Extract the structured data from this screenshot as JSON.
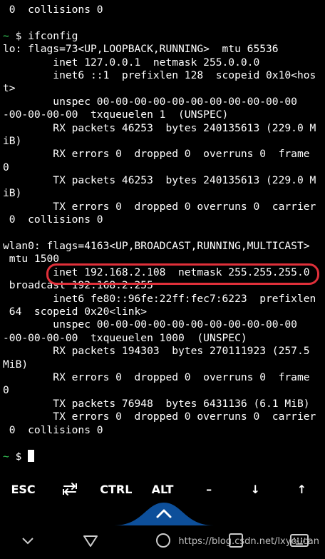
{
  "terminal": {
    "lines": [
      " 0  collisions 0",
      "",
      "~ $ ifconfig",
      "lo: flags=73<UP,LOOPBACK,RUNNING>  mtu 65536",
      "        inet 127.0.0.1  netmask 255.0.0.0",
      "        inet6 ::1  prefixlen 128  scopeid 0x10<hos",
      "t>",
      "        unspec 00-00-00-00-00-00-00-00-00-00-00",
      "-00-00-00-00  txqueuelen 1  (UNSPEC)",
      "        RX packets 46253  bytes 240135613 (229.0 M",
      "iB)",
      "        RX errors 0  dropped 0  overruns 0  frame",
      "0",
      "        TX packets 46253  bytes 240135613 (229.0 M",
      "iB)",
      "        TX errors 0  dropped 0 overruns 0  carrier",
      " 0  collisions 0",
      "",
      "wlan0: flags=4163<UP,BROADCAST,RUNNING,MULTICAST>",
      " mtu 1500",
      "        inet 192.168.2.108  netmask 255.255.255.0",
      " broadcast 192.168.2.255",
      "        inet6 fe80::96fe:22ff:fec7:6223  prefixlen",
      " 64  scopeid 0x20<link>",
      "        unspec 00-00-00-00-00-00-00-00-00-00-00",
      "-00-00-00-00  txqueuelen 1000  (UNSPEC)",
      "        RX packets 194303  bytes 270111923 (257.5",
      "MiB)",
      "        RX errors 0  dropped 0  overruns 0  frame",
      "0",
      "        TX packets 76948  bytes 6431136 (6.1 MiB)",
      "        TX errors 0  dropped 0 overruns 0  carrier",
      " 0  collisions 0",
      ""
    ],
    "prompt_tilde": "~",
    "prompt_symbol": " $ ",
    "prompt_color": "#37d05b",
    "highlight_color": "#e0303a"
  },
  "extra_keys": [
    {
      "label": "ESC",
      "name": "esc-key"
    },
    {
      "label": "",
      "name": "tab-key",
      "icon": "tab-arrows-icon"
    },
    {
      "label": "CTRL",
      "name": "ctrl-key"
    },
    {
      "label": "ALT",
      "name": "alt-key"
    },
    {
      "label": "–",
      "name": "dash-key"
    },
    {
      "label": "↓",
      "name": "down-arrow-key"
    },
    {
      "label": "↑",
      "name": "up-arrow-key"
    }
  ],
  "drawer": {
    "icon": "chevron-up-icon",
    "color": "#0d4f9a"
  },
  "navbar": {
    "icons": [
      "chevron-down-icon",
      "back-triangle-icon",
      "home-circle-icon",
      "recents-square-icon",
      "keyboard-icon"
    ]
  },
  "watermark": "https://blog.csdn.net/lxyoucan"
}
